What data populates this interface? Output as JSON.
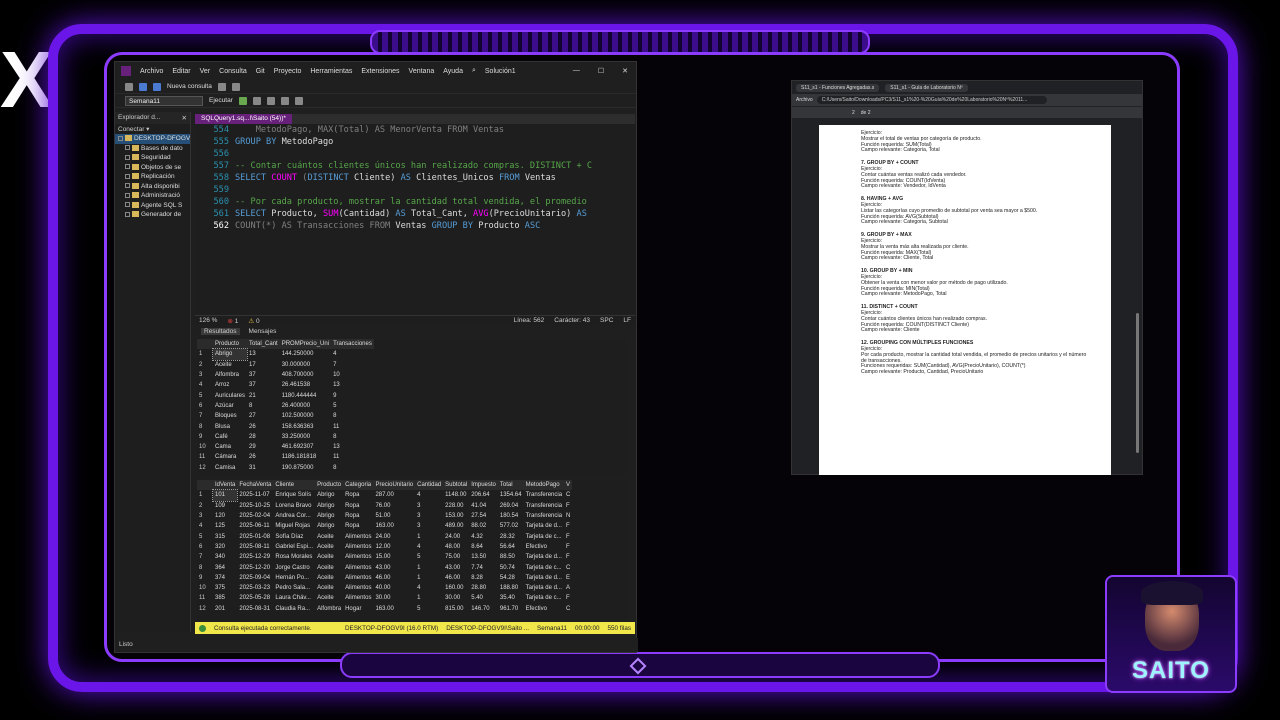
{
  "ssms": {
    "menu": [
      "Archivo",
      "Editar",
      "Ver",
      "Consulta",
      "Git",
      "Proyecto",
      "Herramientas",
      "Extensiones",
      "Ventana",
      "Ayuda"
    ],
    "search_icon": "⌕",
    "solution": "Solución1",
    "toolbar": {
      "new_query": "Nueva consulta",
      "db": "Semana11",
      "execute": "Ejecutar"
    },
    "objexp": {
      "title": "Explorador d...",
      "connect": "Conectar ▾",
      "items": [
        "DESKTOP-DFOGV9I",
        "Bases de dato",
        "Seguridad",
        "Objetos de se",
        "Replicación",
        "Alta disponibi",
        "Administració",
        "Agente SQL S",
        "Generador de"
      ]
    },
    "tab": "SQLQuery1.sq...I\\Saito (54))*",
    "code": [
      {
        "n": "554",
        "parts": [
          {
            "c": "c-gr",
            "t": "    MetodoPago, MAX(Total) AS MenorVenta FROM Ventas"
          }
        ]
      },
      {
        "n": "555",
        "parts": [
          {
            "c": "c-kw",
            "t": "GROUP BY "
          },
          {
            "c": "c-id",
            "t": "MetodoPago"
          }
        ]
      },
      {
        "n": "556",
        "parts": [
          {
            "c": "c-id",
            "t": ""
          }
        ]
      },
      {
        "n": "557",
        "parts": [
          {
            "c": "c-com",
            "t": "-- Contar cuántos clientes únicos han realizado compras. DISTINCT + C"
          }
        ]
      },
      {
        "n": "558",
        "parts": [
          {
            "c": "c-kw",
            "t": "SELECT "
          },
          {
            "c": "c-fn",
            "t": "COUNT "
          },
          {
            "c": "c-gr",
            "t": "("
          },
          {
            "c": "c-kw",
            "t": "DISTINCT "
          },
          {
            "c": "c-id",
            "t": "Cliente) "
          },
          {
            "c": "c-kw",
            "t": "AS "
          },
          {
            "c": "c-id",
            "t": "Clientes_Unicos "
          },
          {
            "c": "c-kw",
            "t": "FROM "
          },
          {
            "c": "c-id",
            "t": "Ventas"
          }
        ]
      },
      {
        "n": "559",
        "parts": [
          {
            "c": "c-id",
            "t": ""
          }
        ]
      },
      {
        "n": "560",
        "parts": [
          {
            "c": "c-com",
            "t": "-- Por cada producto, mostrar la cantidad total vendida, el promedio"
          }
        ]
      },
      {
        "n": "561",
        "parts": [
          {
            "c": "c-kw",
            "t": "SELECT "
          },
          {
            "c": "c-id",
            "t": "Producto, "
          },
          {
            "c": "c-fn",
            "t": "SUM"
          },
          {
            "c": "c-id",
            "t": "(Cantidad) "
          },
          {
            "c": "c-kw",
            "t": "AS "
          },
          {
            "c": "c-id",
            "t": "Total_Cant, "
          },
          {
            "c": "c-fn",
            "t": "AVG"
          },
          {
            "c": "c-id",
            "t": "(PrecioUnitario) "
          },
          {
            "c": "c-kw",
            "t": "AS"
          }
        ]
      },
      {
        "n": "562",
        "parts": [
          {
            "c": "c-gr",
            "t": "COUNT(*) AS Transacciones FROM "
          },
          {
            "c": "c-id",
            "t": "Ventas "
          },
          {
            "c": "c-kw",
            "t": "GROUP BY "
          },
          {
            "c": "c-id",
            "t": "Producto "
          },
          {
            "c": "c-kw",
            "t": "ASC"
          }
        ]
      }
    ],
    "status": {
      "zoom": "126 %",
      "errors": "1",
      "warnings": "0",
      "line": "Línea: 562",
      "char": "Carácter: 43",
      "mode": "SPC",
      "eol": "LF"
    },
    "result_tabs": [
      "Resultados",
      "Mensajes"
    ],
    "grid1": {
      "headers": [
        "",
        "Producto",
        "Total_Cant",
        "PROMPrecio_Uni",
        "Transacciones"
      ],
      "rows": [
        [
          "1",
          "Abrigo",
          "13",
          "144.250000",
          "4"
        ],
        [
          "2",
          "Aceite",
          "17",
          "30.000000",
          "7"
        ],
        [
          "3",
          "Alfombra",
          "37",
          "408.700000",
          "10"
        ],
        [
          "4",
          "Arroz",
          "37",
          "26.461538",
          "13"
        ],
        [
          "5",
          "Auriculares",
          "21",
          "1180.444444",
          "9"
        ],
        [
          "6",
          "Azúcar",
          "8",
          "26.400000",
          "5"
        ],
        [
          "7",
          "Bloques",
          "27",
          "102.500000",
          "8"
        ],
        [
          "8",
          "Blusa",
          "26",
          "158.636363",
          "11"
        ],
        [
          "9",
          "Café",
          "28",
          "33.250000",
          "8"
        ],
        [
          "10",
          "Cama",
          "29",
          "461.692307",
          "13"
        ],
        [
          "11",
          "Cámara",
          "26",
          "1186.181818",
          "11"
        ],
        [
          "12",
          "Camisa",
          "31",
          "190.875000",
          "8"
        ]
      ]
    },
    "grid2": {
      "headers": [
        "",
        "IdVenta",
        "FechaVenta",
        "Cliente",
        "Producto",
        "Categoria",
        "PrecioUnitario",
        "Cantidad",
        "Subtotal",
        "Impuesto",
        "Total",
        "MetodoPago",
        "V"
      ],
      "rows": [
        [
          "1",
          "101",
          "2025-11-07",
          "Enrique Solís",
          "Abrigo",
          "Ropa",
          "287.00",
          "4",
          "1148.00",
          "206.64",
          "1354.64",
          "Transferencia",
          "C"
        ],
        [
          "2",
          "109",
          "2025-10-25",
          "Lorena Bravo",
          "Abrigo",
          "Ropa",
          "76.00",
          "3",
          "228.00",
          "41.04",
          "269.04",
          "Transferencia",
          "F"
        ],
        [
          "3",
          "120",
          "2025-02-04",
          "Andrea Cor...",
          "Abrigo",
          "Ropa",
          "51.00",
          "3",
          "153.00",
          "27.54",
          "180.54",
          "Transferencia",
          "N"
        ],
        [
          "4",
          "125",
          "2025-06-11",
          "Miguel Rojas",
          "Abrigo",
          "Ropa",
          "163.00",
          "3",
          "489.00",
          "88.02",
          "577.02",
          "Tarjeta de d...",
          "F"
        ],
        [
          "5",
          "315",
          "2025-01-08",
          "Sofía Díaz",
          "Aceite",
          "Alimentos",
          "24.00",
          "1",
          "24.00",
          "4.32",
          "28.32",
          "Tarjeta de c...",
          "F"
        ],
        [
          "6",
          "320",
          "2025-08-11",
          "Gabriel Espi...",
          "Aceite",
          "Alimentos",
          "12.00",
          "4",
          "48.00",
          "8.64",
          "56.64",
          "Efectivo",
          "F"
        ],
        [
          "7",
          "340",
          "2025-12-29",
          "Rosa Morales",
          "Aceite",
          "Alimentos",
          "15.00",
          "5",
          "75.00",
          "13.50",
          "88.50",
          "Tarjeta de d...",
          "F"
        ],
        [
          "8",
          "364",
          "2025-12-20",
          "Jorge Castro",
          "Aceite",
          "Alimentos",
          "43.00",
          "1",
          "43.00",
          "7.74",
          "50.74",
          "Tarjeta de c...",
          "C"
        ],
        [
          "9",
          "374",
          "2025-09-04",
          "Hernán Po...",
          "Aceite",
          "Alimentos",
          "46.00",
          "1",
          "46.00",
          "8.28",
          "54.28",
          "Tarjeta de d...",
          "E"
        ],
        [
          "10",
          "375",
          "2025-03-23",
          "Pedro Sala...",
          "Aceite",
          "Alimentos",
          "40.00",
          "4",
          "160.00",
          "28.80",
          "188.80",
          "Tarjeta de d...",
          "A"
        ],
        [
          "11",
          "385",
          "2025-05-28",
          "Laura Cháv...",
          "Aceite",
          "Alimentos",
          "30.00",
          "1",
          "30.00",
          "5.40",
          "35.40",
          "Tarjeta de c...",
          "F"
        ],
        [
          "12",
          "201",
          "2025-08-31",
          "Claudia Ra...",
          "Alfombra",
          "Hogar",
          "163.00",
          "5",
          "815.00",
          "146.70",
          "961.70",
          "Efectivo",
          "C"
        ]
      ]
    },
    "ok": {
      "msg": "Consulta ejecutada correctamente.",
      "server": "DESKTOP-DFOGV9I (16.0 RTM)",
      "user": "DESKTOP-DFOGV9I\\Saito ...",
      "db": "Semana11",
      "time": "00:00:00",
      "rows": "550 filas"
    },
    "ready": "Listo"
  },
  "pdf": {
    "tabs": [
      "S11_s1 - Funciones Agregadas.s",
      "S11_s1 - Guía de Laboratorio Nº"
    ],
    "address": "C:/Users/Saito/Downloads/PC3/S11_s1%20-%20Guía%20de%20Laboratorio%20Nº%2011...",
    "page_label": "Archivo",
    "page_num": "2",
    "page_total": "de 2",
    "sections": [
      {
        "head": "",
        "lines": [
          "Ejercicio:",
          "Mostrar el total de ventas por categoría de producto.",
          "Función requerida: SUM(Total)",
          "Campo relevante: Categoria, Total"
        ]
      },
      {
        "head": "7. GROUP BY + COUNT",
        "lines": [
          "Ejercicio:",
          "Contar cuántas ventas realizó cada vendedor.",
          "Función requerida: COUNT(IdVenta)",
          "Campo relevante: Vendedor, IdVenta"
        ]
      },
      {
        "head": "8. HAVING + AVG",
        "lines": [
          "Ejercicio:",
          "Listar las categorías cuyo promedio de subtotal por venta sea mayor a $500.",
          "Función requerida: AVG(Subtotal)",
          "Campo relevante: Categoria, Subtotal"
        ]
      },
      {
        "head": "9. GROUP BY + MAX",
        "lines": [
          "Ejercicio:",
          "Mostrar la venta más alta realizada por cliente.",
          "Función requerida: MAX(Total)",
          "Campo relevante: Cliente, Total"
        ]
      },
      {
        "head": "10. GROUP BY + MIN",
        "lines": [
          "Ejercicio:",
          "Obtener la venta con menor valor por método de pago utilizado.",
          "Función requerida: MIN(Total)",
          "Campo relevante: MetodoPago, Total"
        ]
      },
      {
        "head": "11. DISTINCT + COUNT",
        "lines": [
          "Ejercicio:",
          "Contar cuántos clientes únicos han realizado compras.",
          "Función requerida: COUNT(DISTINCT Cliente)",
          "Campo relevante: Cliente"
        ]
      },
      {
        "head": "12. GROUPING CON MÚLTIPLES FUNCIONES",
        "lines": [
          "Ejercicio:",
          "Por cada producto, mostrar la cantidad total vendida, el promedio de precios unitarios y el número",
          "de transacciones.",
          "Funciones requeridas: SUM(Cantidad), AVG(PrecioUnitario), COUNT(*)",
          "Campo relevante: Producto, Cantidad, PrecioUnitario"
        ]
      }
    ]
  },
  "logo": {
    "text": "SAITO"
  },
  "overlay": {
    "x": "X"
  }
}
